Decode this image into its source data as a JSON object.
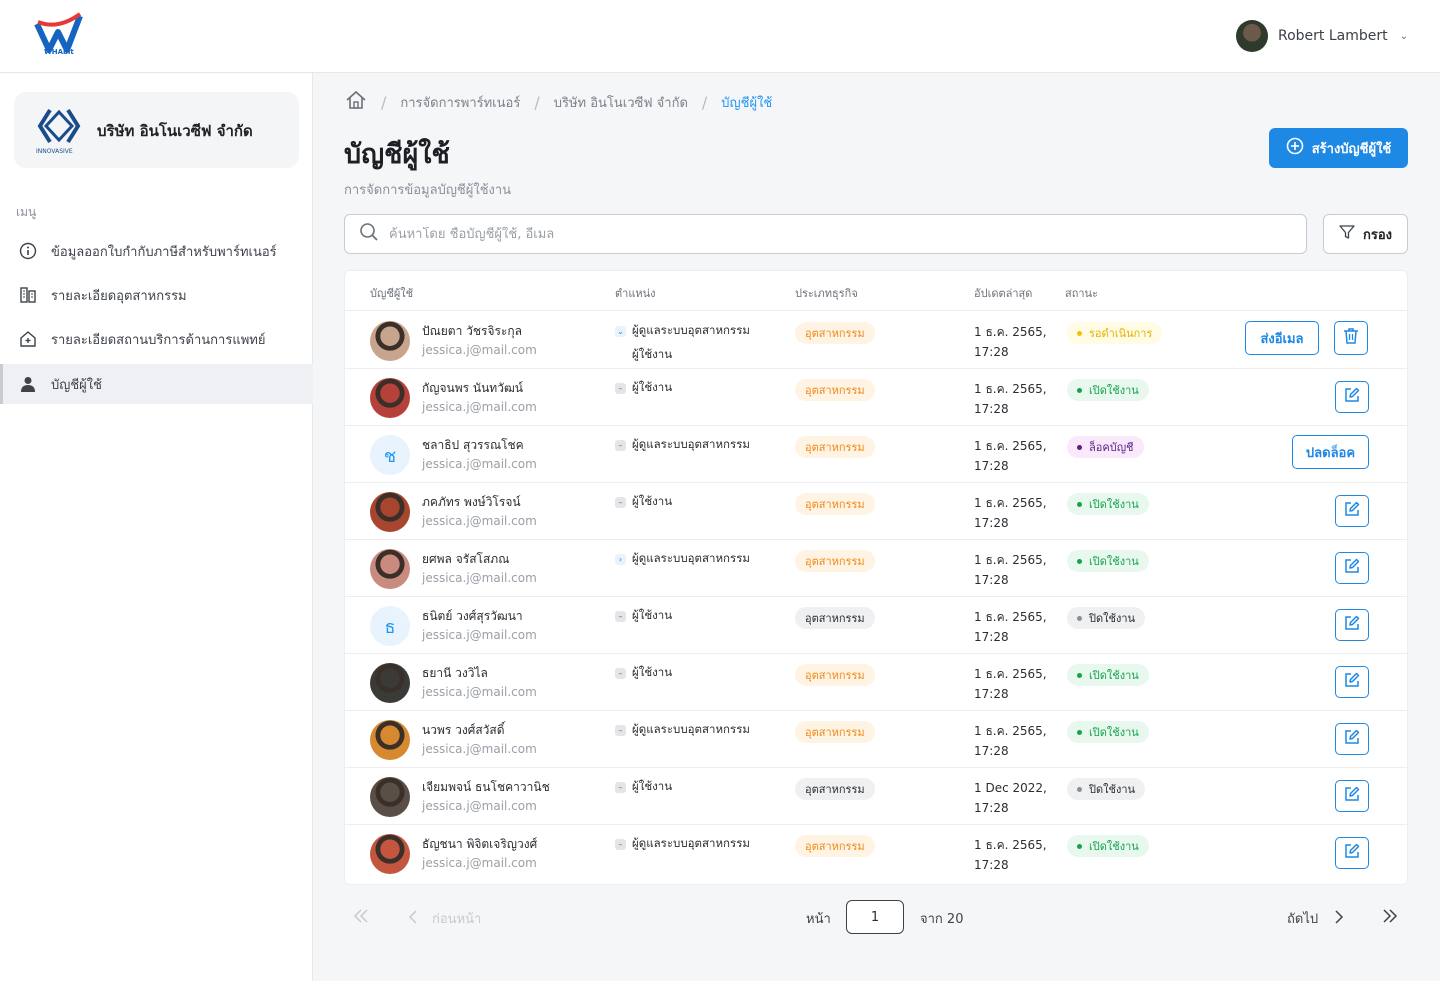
{
  "header": {
    "logo_text": "WHAbit",
    "user_name": "Robert Lambert"
  },
  "sidebar": {
    "company_name": "บริษัท อินโนเวซีฟ จำกัด",
    "company_logo_text": "INNOVASIVE",
    "menu_title": "เมนู",
    "items": [
      {
        "label": "ข้อมูลออกใบกำกับภาษีสำหรับพาร์ทเนอร์",
        "icon": "info-icon"
      },
      {
        "label": "รายละเอียดอุตสาหกรรม",
        "icon": "building-icon"
      },
      {
        "label": "รายละเอียดสถานบริการด้านการแพทย์",
        "icon": "hospital-icon"
      },
      {
        "label": "บัญชีผู้ใช้",
        "icon": "user-icon"
      }
    ]
  },
  "breadcrumb": [
    "การจัดการพาร์ทเนอร์",
    "บริษัท อินโนเวซีฟ จำกัด",
    "บัญชีผู้ใช้"
  ],
  "page": {
    "title": "บัญชีผู้ใช้",
    "subtitle": "การจัดการข้อมูลบัญชีผู้ใช้งาน",
    "create_label": "สร้างบัญชีผู้ใช้",
    "search_placeholder": "ค้นหาโดย ชื่อบัญชีผู้ใช้, อีเมล",
    "filter_label": "กรอง"
  },
  "table": {
    "columns": [
      "บัญชีผู้ใช้",
      "ตำแหน่ง",
      "ประเภทธุรกิจ",
      "อัปเดตล่าสุด",
      "สถานะ"
    ],
    "rows": [
      {
        "name": "ปัณยตา วัชรจิระกุล",
        "email": "jessica.j@mail.com",
        "role": "ผู้ดูแลระบบอุตสาหกรรม",
        "role2": "ผู้ใช้งาน",
        "role_marker": "down",
        "business": "อุตสาหกรรม",
        "biz_style": "orange",
        "date": "1 ธ.ค. 2565,",
        "time": "17:28",
        "status": "รอดำเนินการ",
        "status_style": "pending",
        "actions": [
          "send_email",
          "delete"
        ],
        "avatar": "photo",
        "avatar_color": "#c9a48c"
      },
      {
        "name": "กัญจนพร นันทวัฒน์",
        "email": "jessica.j@mail.com",
        "role": "ผู้ใช้งาน",
        "role_marker": "minus",
        "business": "อุตสาหกรรม",
        "biz_style": "orange",
        "date": "1 ธ.ค. 2565,",
        "time": "17:28",
        "status": "เปิดใช้งาน",
        "status_style": "active",
        "actions": [
          "edit"
        ],
        "avatar": "photo",
        "avatar_color": "#b5413a"
      },
      {
        "name": "ชลาธิป สุวรรณโชค",
        "email": "jessica.j@mail.com",
        "role": "ผู้ดูแลระบบอุตสาหกรรม",
        "role_marker": "minus",
        "business": "อุตสาหกรรม",
        "biz_style": "orange",
        "date": "1 ธ.ค. 2565,",
        "time": "17:28",
        "status": "ล็อคบัญชี",
        "status_style": "locked",
        "actions": [
          "unlock"
        ],
        "avatar": "ช",
        "avatar_color": "#e8f3fd"
      },
      {
        "name": "ภคภัทร พงษ์วิโรจน์",
        "email": "jessica.j@mail.com",
        "role": "ผู้ใช้งาน",
        "role_marker": "minus",
        "business": "อุตสาหกรรม",
        "biz_style": "orange",
        "date": "1 ธ.ค. 2565,",
        "time": "17:28",
        "status": "เปิดใช้งาน",
        "status_style": "active",
        "actions": [
          "edit"
        ],
        "avatar": "photo",
        "avatar_color": "#a8452e"
      },
      {
        "name": "ยศพล จรัสโสภณ",
        "email": "jessica.j@mail.com",
        "role": "ผู้ดูแลระบบอุตสาหกรรม",
        "role_marker": "right",
        "business": "อุตสาหกรรม",
        "biz_style": "orange",
        "date": "1 ธ.ค. 2565,",
        "time": "17:28",
        "status": "เปิดใช้งาน",
        "status_style": "active",
        "actions": [
          "edit"
        ],
        "avatar": "photo",
        "avatar_color": "#c98b7e"
      },
      {
        "name": "ธนิตย์ วงศ์สุรวัฒนา",
        "email": "jessica.j@mail.com",
        "role": "ผู้ใช้งาน",
        "role_marker": "minus",
        "business": "อุตสาหกรรม",
        "biz_style": "gray",
        "date": "1 ธ.ค. 2565,",
        "time": "17:28",
        "status": "ปิดใช้งาน",
        "status_style": "off",
        "actions": [
          "edit"
        ],
        "avatar": "ธ",
        "avatar_color": "#e8f3fd"
      },
      {
        "name": "ธยานี วงวิไล",
        "email": "jessica.j@mail.com",
        "role": "ผู้ใช้งาน",
        "role_marker": "minus",
        "business": "อุตสาหกรรม",
        "biz_style": "orange",
        "date": "1 ธ.ค. 2565,",
        "time": "17:28",
        "status": "เปิดใช้งาน",
        "status_style": "active",
        "actions": [
          "edit"
        ],
        "avatar": "photo",
        "avatar_color": "#3a3a36"
      },
      {
        "name": "นวพร วงศ์สวัสดิ์",
        "email": "jessica.j@mail.com",
        "role": "ผู้ดูแลระบบอุตสาหกรรม",
        "role_marker": "minus",
        "business": "อุตสาหกรรม",
        "biz_style": "orange",
        "date": "1 ธ.ค. 2565,",
        "time": "17:28",
        "status": "เปิดใช้งาน",
        "status_style": "active",
        "actions": [
          "edit"
        ],
        "avatar": "photo",
        "avatar_color": "#d6892e"
      },
      {
        "name": "เจียมพจน์ ธนโชคาวานิช",
        "email": "jessica.j@mail.com",
        "role": "ผู้ใช้งาน",
        "role_marker": "minus",
        "business": "อุตสาหกรรม",
        "biz_style": "gray",
        "date": "1 Dec 2022,",
        "time": "17:28",
        "status": "ปิดใช้งาน",
        "status_style": "off",
        "actions": [
          "edit"
        ],
        "avatar": "photo",
        "avatar_color": "#5a4f46"
      },
      {
        "name": "ธัญชนา พิจิตเจริญวงศ์",
        "email": "jessica.j@mail.com",
        "role": "ผู้ดูแลระบบอุตสาหกรรม",
        "role_marker": "minus",
        "business": "อุตสาหกรรม",
        "biz_style": "orange",
        "date": "1 ธ.ค. 2565,",
        "time": "17:28",
        "status": "เปิดใช้งาน",
        "status_style": "active",
        "actions": [
          "edit"
        ],
        "avatar": "photo",
        "avatar_color": "#c4553f"
      }
    ],
    "action_labels": {
      "send_email": "ส่งอีเมล",
      "unlock": "ปลดล็อค"
    }
  },
  "pagination": {
    "prev_label": "ก่อนหน้า",
    "page_label": "หน้า",
    "current_page": "1",
    "of_label": "จาก 20",
    "next_label": "ถัดไป"
  },
  "colors": {
    "accent": "#1e88e5",
    "active": "#16a34a",
    "pending": "#f2c400",
    "locked": "#5b1e88",
    "industry": "#ef8a17"
  }
}
